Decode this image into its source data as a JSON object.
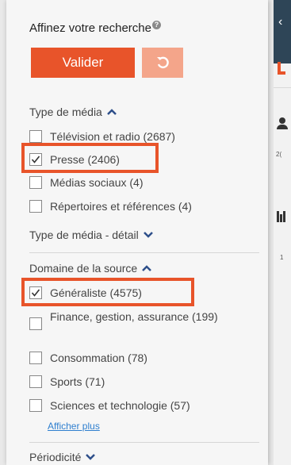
{
  "filters": {
    "title": "Affinez votre recherche",
    "help_glyph": "?",
    "validate_label": "Valider",
    "media_type": {
      "heading": "Type de média",
      "options": [
        {
          "label": "Télévision et radio (2687)",
          "checked": false
        },
        {
          "label": "Presse (2406)",
          "checked": true
        },
        {
          "label": "Médias sociaux (4)",
          "checked": false
        },
        {
          "label": "Répertoires et références (4)",
          "checked": false
        }
      ]
    },
    "media_type_detail": {
      "heading": "Type de média - détail"
    },
    "source_domain": {
      "heading": "Domaine de la source",
      "options": [
        {
          "label": "Généraliste (4575)",
          "checked": true
        },
        {
          "label": "Finance, gestion, assurance (199)",
          "checked": false
        },
        {
          "label": "Consommation (78)",
          "checked": false
        },
        {
          "label": "Sports (71)",
          "checked": false
        },
        {
          "label": "Sciences et technologie (57)",
          "checked": false
        }
      ],
      "show_more": "Afficher plus"
    },
    "periodicity": {
      "heading": "Périodicité"
    }
  },
  "side_strip": {
    "text_1": "2(",
    "text_2": "1"
  },
  "colors": {
    "accent": "#e8542a",
    "accent_light": "#f4a58a",
    "link": "#2f7fcf",
    "strip_dark": "#2e4557"
  }
}
